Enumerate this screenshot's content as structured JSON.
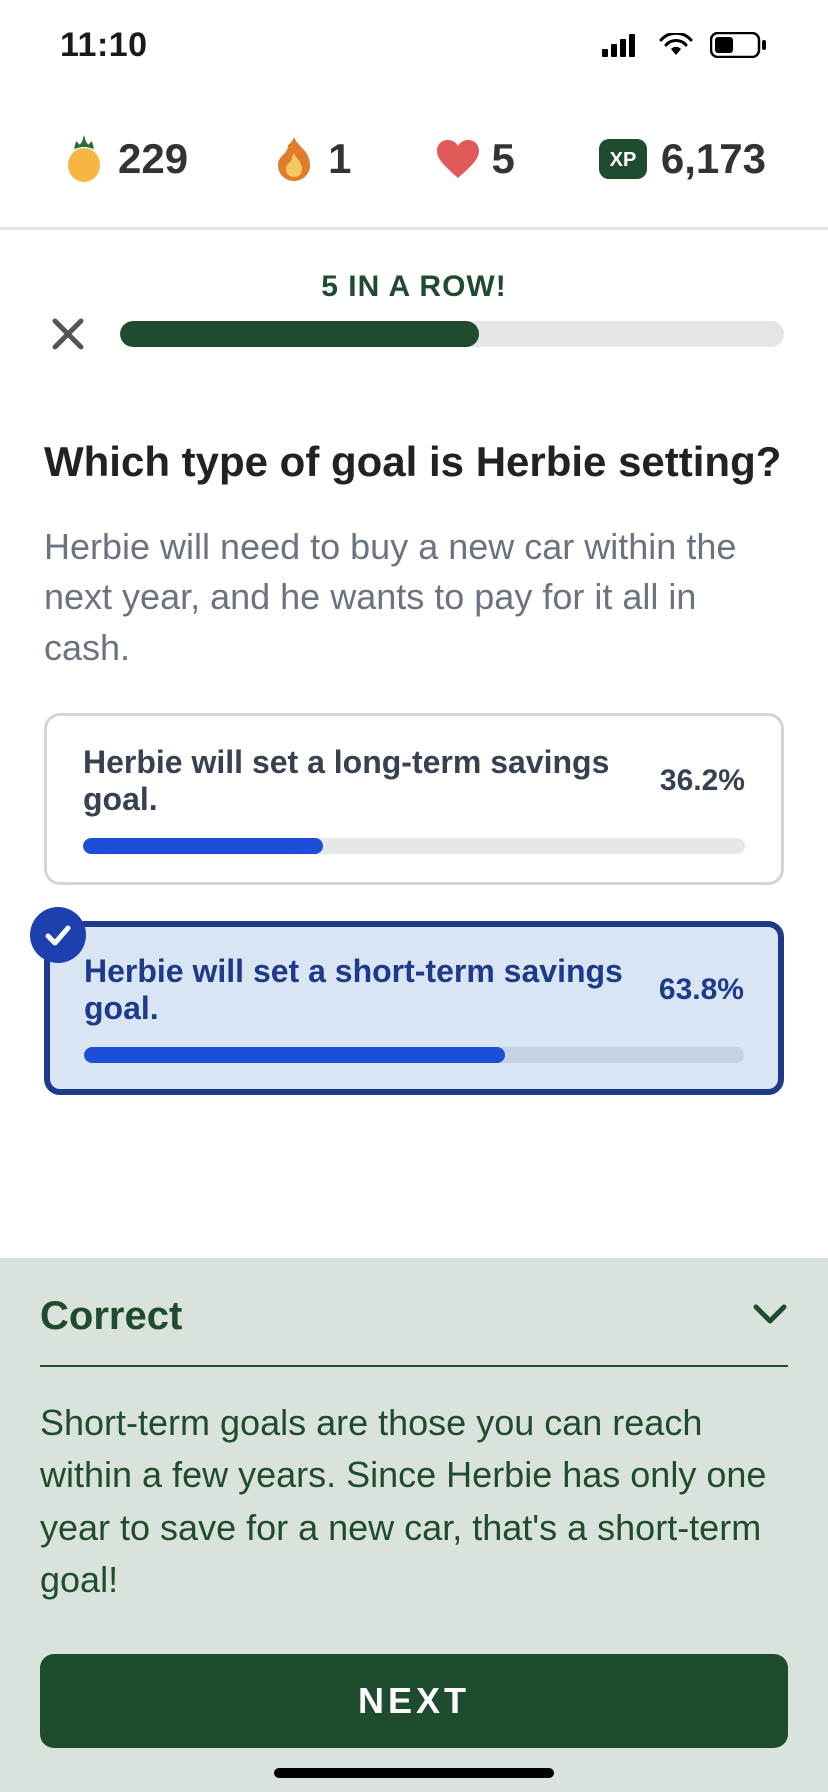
{
  "status": {
    "time": "11:10"
  },
  "stats": {
    "pineapple": "229",
    "fire": "1",
    "heart": "5",
    "xp": "6,173"
  },
  "progress": {
    "streak_label": "5 IN A ROW!",
    "percent": 54
  },
  "question": {
    "title": "Which type of goal is Herbie setting?",
    "body": "Herbie will need to buy a new car within the next year, and he wants to pay for it all in cash."
  },
  "answers": [
    {
      "text": "Herbie will set a long-term savings goal.",
      "percent_label": "36.2%",
      "percent": 36.2,
      "selected": false,
      "correct": false
    },
    {
      "text": "Herbie will set a short-term savings goal.",
      "percent_label": "63.8%",
      "percent": 63.8,
      "selected": true,
      "correct": true
    }
  ],
  "feedback": {
    "title": "Correct",
    "body": "Short-term goals are those you can reach within a few years. Since Herbie has only one year to save for a new car, that's a short-term goal!",
    "button": "NEXT"
  }
}
